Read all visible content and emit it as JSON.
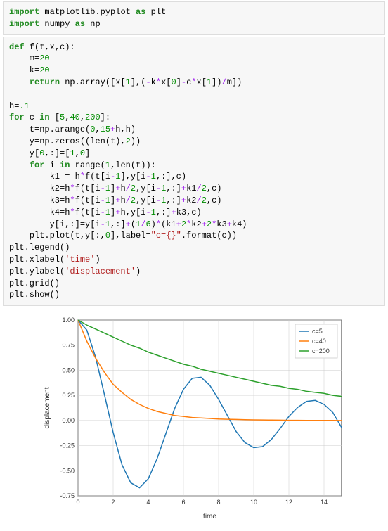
{
  "code_block_1": {
    "lines": [
      [
        [
          "kw",
          "import"
        ],
        [
          "name",
          " matplotlib.pyplot "
        ],
        [
          "kw",
          "as"
        ],
        [
          "name",
          " plt"
        ]
      ],
      [
        [
          "kw",
          "import"
        ],
        [
          "name",
          " numpy "
        ],
        [
          "kw",
          "as"
        ],
        [
          "name",
          " np"
        ]
      ]
    ]
  },
  "code_block_2": {
    "lines": [
      [
        [
          "kw",
          "def"
        ],
        [
          "name",
          " f(t,x,c):"
        ]
      ],
      [
        [
          "name",
          "    m="
        ],
        [
          "num",
          "20"
        ]
      ],
      [
        [
          "name",
          "    k="
        ],
        [
          "num",
          "20"
        ]
      ],
      [
        [
          "name",
          "    "
        ],
        [
          "kw",
          "return"
        ],
        [
          "name",
          " np.array([x["
        ],
        [
          "num",
          "1"
        ],
        [
          "name",
          "],("
        ],
        [
          "op",
          "-"
        ],
        [
          "name",
          "k"
        ],
        [
          "op",
          "*"
        ],
        [
          "name",
          "x["
        ],
        [
          "num",
          "0"
        ],
        [
          "name",
          "]"
        ],
        [
          "op",
          "-"
        ],
        [
          "name",
          "c"
        ],
        [
          "op",
          "*"
        ],
        [
          "name",
          "x["
        ],
        [
          "num",
          "1"
        ],
        [
          "name",
          "])"
        ],
        [
          "op",
          "/"
        ],
        [
          "name",
          "m])"
        ]
      ],
      [
        [
          "name",
          ""
        ]
      ],
      [
        [
          "name",
          "h="
        ],
        [
          "num",
          ".1"
        ]
      ],
      [
        [
          "kw",
          "for"
        ],
        [
          "name",
          " c "
        ],
        [
          "kw",
          "in"
        ],
        [
          "name",
          " ["
        ],
        [
          "num",
          "5"
        ],
        [
          "name",
          ","
        ],
        [
          "num",
          "40"
        ],
        [
          "name",
          ","
        ],
        [
          "num",
          "200"
        ],
        [
          "name",
          "]:"
        ]
      ],
      [
        [
          "name",
          "    t=np.arange("
        ],
        [
          "num",
          "0"
        ],
        [
          "name",
          ","
        ],
        [
          "num",
          "15"
        ],
        [
          "op",
          "+"
        ],
        [
          "name",
          "h,h)"
        ]
      ],
      [
        [
          "name",
          "    y=np.zeros((len(t),"
        ],
        [
          "num",
          "2"
        ],
        [
          "name",
          "))"
        ]
      ],
      [
        [
          "name",
          "    y["
        ],
        [
          "num",
          "0"
        ],
        [
          "name",
          ",:]=["
        ],
        [
          "num",
          "1"
        ],
        [
          "name",
          ","
        ],
        [
          "num",
          "0"
        ],
        [
          "name",
          "]"
        ]
      ],
      [
        [
          "name",
          "    "
        ],
        [
          "kw",
          "for"
        ],
        [
          "name",
          " i "
        ],
        [
          "kw",
          "in"
        ],
        [
          "name",
          " range("
        ],
        [
          "num",
          "1"
        ],
        [
          "name",
          ",len(t)):"
        ]
      ],
      [
        [
          "name",
          "        k1 = h"
        ],
        [
          "op",
          "*"
        ],
        [
          "name",
          "f(t[i"
        ],
        [
          "op",
          "-"
        ],
        [
          "num",
          "1"
        ],
        [
          "name",
          "],y[i"
        ],
        [
          "op",
          "-"
        ],
        [
          "num",
          "1"
        ],
        [
          "name",
          ",:],c)"
        ]
      ],
      [
        [
          "name",
          "        k2=h"
        ],
        [
          "op",
          "*"
        ],
        [
          "name",
          "f(t[i"
        ],
        [
          "op",
          "-"
        ],
        [
          "num",
          "1"
        ],
        [
          "name",
          "]"
        ],
        [
          "op",
          "+"
        ],
        [
          "name",
          "h"
        ],
        [
          "op",
          "/"
        ],
        [
          "num",
          "2"
        ],
        [
          "name",
          ",y[i"
        ],
        [
          "op",
          "-"
        ],
        [
          "num",
          "1"
        ],
        [
          "name",
          ",:]"
        ],
        [
          "op",
          "+"
        ],
        [
          "name",
          "k1"
        ],
        [
          "op",
          "/"
        ],
        [
          "num",
          "2"
        ],
        [
          "name",
          ",c)"
        ]
      ],
      [
        [
          "name",
          "        k3=h"
        ],
        [
          "op",
          "*"
        ],
        [
          "name",
          "f(t[i"
        ],
        [
          "op",
          "-"
        ],
        [
          "num",
          "1"
        ],
        [
          "name",
          "]"
        ],
        [
          "op",
          "+"
        ],
        [
          "name",
          "h"
        ],
        [
          "op",
          "/"
        ],
        [
          "num",
          "2"
        ],
        [
          "name",
          ",y[i"
        ],
        [
          "op",
          "-"
        ],
        [
          "num",
          "1"
        ],
        [
          "name",
          ",:]"
        ],
        [
          "op",
          "+"
        ],
        [
          "name",
          "k2"
        ],
        [
          "op",
          "/"
        ],
        [
          "num",
          "2"
        ],
        [
          "name",
          ",c)"
        ]
      ],
      [
        [
          "name",
          "        k4=h"
        ],
        [
          "op",
          "*"
        ],
        [
          "name",
          "f(t[i"
        ],
        [
          "op",
          "-"
        ],
        [
          "num",
          "1"
        ],
        [
          "name",
          "]"
        ],
        [
          "op",
          "+"
        ],
        [
          "name",
          "h,y[i"
        ],
        [
          "op",
          "-"
        ],
        [
          "num",
          "1"
        ],
        [
          "name",
          ",:]"
        ],
        [
          "op",
          "+"
        ],
        [
          "name",
          "k3,c)"
        ]
      ],
      [
        [
          "name",
          "        y[i,:]=y[i"
        ],
        [
          "op",
          "-"
        ],
        [
          "num",
          "1"
        ],
        [
          "name",
          ",:]"
        ],
        [
          "op",
          "+"
        ],
        [
          "name",
          "("
        ],
        [
          "num",
          "1"
        ],
        [
          "op",
          "/"
        ],
        [
          "num",
          "6"
        ],
        [
          "name",
          ")"
        ],
        [
          "op",
          "*"
        ],
        [
          "name",
          "(k1"
        ],
        [
          "op",
          "+"
        ],
        [
          "num",
          "2"
        ],
        [
          "op",
          "*"
        ],
        [
          "name",
          "k2"
        ],
        [
          "op",
          "+"
        ],
        [
          "num",
          "2"
        ],
        [
          "op",
          "*"
        ],
        [
          "name",
          "k3"
        ],
        [
          "op",
          "+"
        ],
        [
          "name",
          "k4)"
        ]
      ],
      [
        [
          "name",
          "    plt.plot(t,y[:,"
        ],
        [
          "num",
          "0"
        ],
        [
          "name",
          "],label="
        ],
        [
          "str",
          "\"c={}\""
        ],
        [
          "name",
          ".format(c))"
        ]
      ],
      [
        [
          "name",
          "plt.legend()"
        ]
      ],
      [
        [
          "name",
          "plt.xlabel("
        ],
        [
          "str",
          "'time'"
        ],
        [
          "name",
          ")"
        ]
      ],
      [
        [
          "name",
          "plt.ylabel("
        ],
        [
          "str",
          "'displacement'"
        ],
        [
          "name",
          ")"
        ]
      ],
      [
        [
          "name",
          "plt.grid()"
        ]
      ],
      [
        [
          "name",
          "plt.show()"
        ]
      ]
    ]
  },
  "chart_data": {
    "type": "line",
    "title": "",
    "xlabel": "time",
    "ylabel": "displacement",
    "xlim": [
      0,
      15
    ],
    "ylim": [
      -0.75,
      1.0
    ],
    "xticks": [
      0,
      2,
      4,
      6,
      8,
      10,
      12,
      14
    ],
    "yticks": [
      -0.75,
      -0.5,
      -0.25,
      0.0,
      0.25,
      0.5,
      0.75,
      1.0
    ],
    "grid": true,
    "legend_position": "upper right",
    "x": [
      0,
      0.5,
      1,
      1.5,
      2,
      2.5,
      3,
      3.5,
      4,
      4.5,
      5,
      5.5,
      6,
      6.5,
      7,
      7.5,
      8,
      8.5,
      9,
      9.5,
      10,
      10.5,
      11,
      11.5,
      12,
      12.5,
      13,
      13.5,
      14,
      14.5,
      15
    ],
    "series": [
      {
        "name": "c=5",
        "color": "#1f77b4",
        "values": [
          1.0,
          0.9,
          0.63,
          0.26,
          -0.12,
          -0.44,
          -0.62,
          -0.67,
          -0.58,
          -0.38,
          -0.13,
          0.12,
          0.31,
          0.42,
          0.43,
          0.35,
          0.21,
          0.05,
          -0.11,
          -0.22,
          -0.27,
          -0.26,
          -0.19,
          -0.08,
          0.04,
          0.13,
          0.19,
          0.2,
          0.16,
          0.08,
          -0.07
        ]
      },
      {
        "name": "c=40",
        "color": "#ff7f0e",
        "values": [
          1.0,
          0.79,
          0.62,
          0.48,
          0.36,
          0.28,
          0.21,
          0.16,
          0.12,
          0.09,
          0.07,
          0.05,
          0.04,
          0.03,
          0.025,
          0.02,
          0.015,
          0.012,
          0.01,
          0.008,
          0.006,
          0.005,
          0.004,
          0.003,
          0.002,
          0.002,
          0.001,
          0.001,
          0.001,
          0.001,
          0.0
        ]
      },
      {
        "name": "c=200",
        "color": "#2ca02c",
        "values": [
          1.0,
          0.95,
          0.91,
          0.87,
          0.83,
          0.79,
          0.75,
          0.72,
          0.68,
          0.65,
          0.62,
          0.59,
          0.56,
          0.54,
          0.51,
          0.49,
          0.47,
          0.45,
          0.43,
          0.41,
          0.39,
          0.37,
          0.35,
          0.34,
          0.32,
          0.31,
          0.29,
          0.28,
          0.27,
          0.25,
          0.24
        ]
      }
    ]
  }
}
